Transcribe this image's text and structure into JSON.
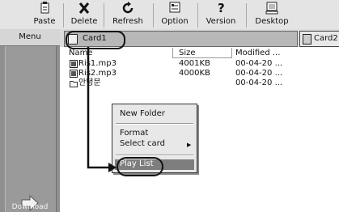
{
  "toolbar": {
    "paste_label": "Paste",
    "delete_label": "Delete",
    "refresh_label": "Refresh",
    "option_label": "Option",
    "version_label": "Version",
    "desktop_label": "Desktop"
  },
  "sidebar": {
    "menu_label": "Menu",
    "download_label": "Download"
  },
  "tabs": {
    "active": "Card1",
    "other": "Card2"
  },
  "list": {
    "columns": [
      "Name",
      "Size",
      "Modified ..."
    ],
    "rows": [
      {
        "name": "Ris1.mp3",
        "size": "4001KB",
        "modified": "00-04-20 ...",
        "icon": "music-file-icon"
      },
      {
        "name": "Ris2.mp3",
        "size": "4000KB",
        "modified": "00-04-20 ...",
        "icon": "music-file-icon"
      },
      {
        "name": "안녕문",
        "size": "",
        "modified": "00-04-20 ...",
        "icon": "folder-icon"
      }
    ]
  },
  "context_menu": {
    "new_folder": "New Folder",
    "format": "Format",
    "select_card": "Select card",
    "play_list": "Play List"
  },
  "colors": {
    "toolbar_bg": "#e4e4e4",
    "sidebar_bg": "#8f8f8f",
    "active_tab_bg": "#b8b8b8",
    "menu_highlight": "#7e7e7e"
  }
}
